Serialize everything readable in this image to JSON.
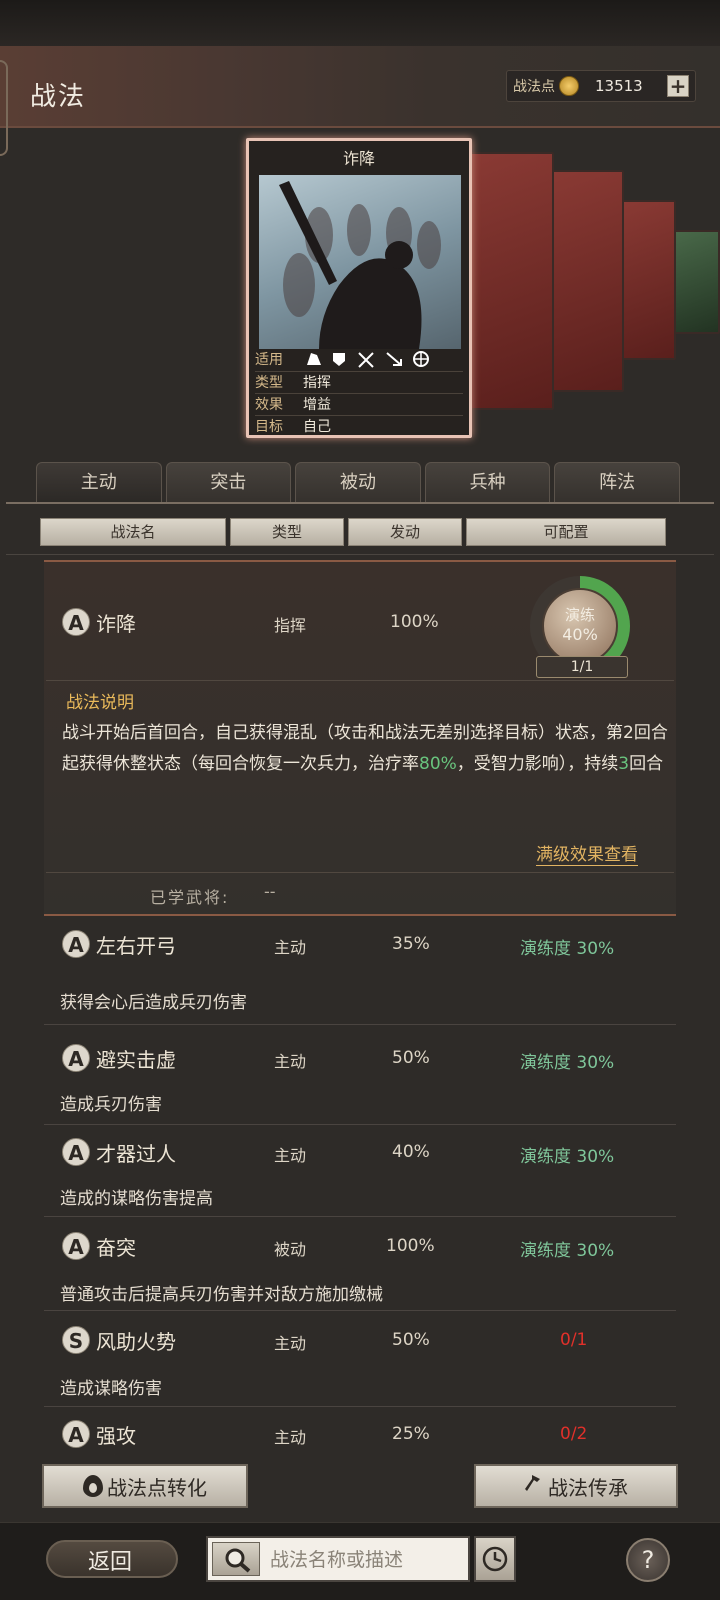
{
  "header": {
    "title": "战法",
    "points_label": "战法点",
    "points_value": "13513",
    "plus_icon": "plus-icon"
  },
  "card": {
    "title": "诈降",
    "rows": [
      {
        "key": "适用",
        "value": ""
      },
      {
        "key": "类型",
        "value": "指挥"
      },
      {
        "key": "效果",
        "value": "增益"
      },
      {
        "key": "目标",
        "value": "自己"
      }
    ]
  },
  "tabs": [
    "主动",
    "突击",
    "被动",
    "兵种",
    "阵法"
  ],
  "columns": [
    "战法名",
    "类型",
    "发动",
    "可配置"
  ],
  "expanded": {
    "grade": "A",
    "name": "诈降",
    "type": "指挥",
    "rate": "100%",
    "practice_label": "演练",
    "practice_pct": "40%",
    "practice_count": "1/1",
    "desc_title": "战法说明",
    "desc_1": "战斗开始后首回合，自己获得混乱（攻击和战法无差别选择目标）状态，第2回合起获得休整状态（每回合恢复一次兵力，治疗率",
    "desc_heal": "80%",
    "desc_2": "，受智力影响），持续",
    "desc_turns": "3",
    "desc_3": "回合",
    "full_effect_link": "满级效果查看",
    "learned_label": "已学武将:",
    "learned_value": "--"
  },
  "skills": [
    {
      "grade": "A",
      "name": "左右开弓",
      "type": "主动",
      "rate": "35%",
      "practice": "演练度 30%",
      "desc": "获得会心后造成兵刃伤害"
    },
    {
      "grade": "A",
      "name": "避实击虚",
      "type": "主动",
      "rate": "50%",
      "practice": "演练度 30%",
      "desc": "造成兵刃伤害"
    },
    {
      "grade": "A",
      "name": "才器过人",
      "type": "主动",
      "rate": "40%",
      "practice": "演练度 30%",
      "desc": "造成的谋略伤害提高"
    },
    {
      "grade": "A",
      "name": "奋突",
      "type": "被动",
      "rate": "100%",
      "practice": "演练度 30%",
      "desc": "普通攻击后提高兵刃伤害并对敌方施加缴械"
    },
    {
      "grade": "S",
      "name": "风助火势",
      "type": "主动",
      "rate": "50%",
      "count": "0/1",
      "desc": "造成谋略伤害"
    },
    {
      "grade": "A",
      "name": "强攻",
      "type": "主动",
      "rate": "25%",
      "count": "0/2",
      "desc": ""
    }
  ],
  "buttons": {
    "convert": "战法点转化",
    "inherit": "战法传承"
  },
  "footer": {
    "back": "返回",
    "search_placeholder": "战法名称或描述",
    "help": "?"
  }
}
